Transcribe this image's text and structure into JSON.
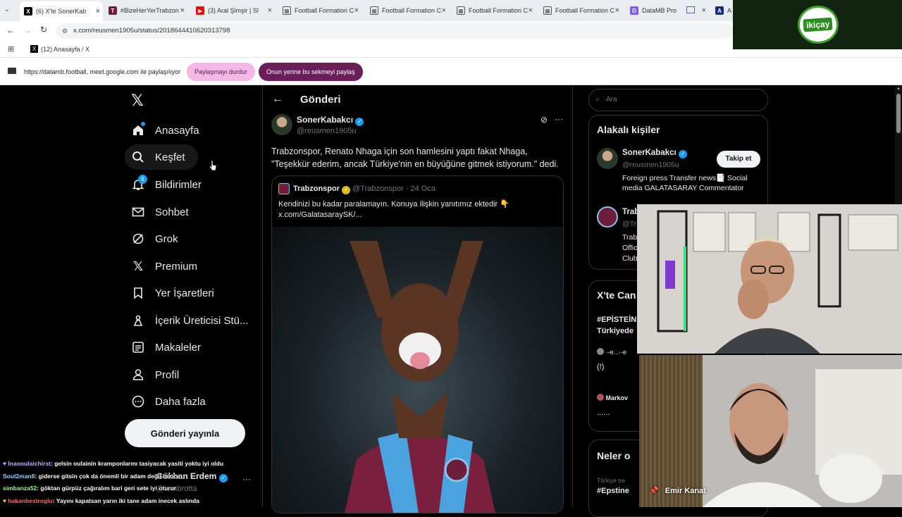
{
  "browser": {
    "tabs": [
      {
        "label": "(6) X'te SonerKab",
        "icon": "x-icon",
        "active": true
      },
      {
        "label": "#BizeHerYerTrabzon",
        "icon": "trabzon-icon"
      },
      {
        "label": "(3) Aral Şimşir | Sl",
        "icon": "youtube-icon"
      },
      {
        "label": "Football Formation C",
        "icon": "doc-icon"
      },
      {
        "label": "Football Formation C",
        "icon": "doc-icon"
      },
      {
        "label": "Football Formation C",
        "icon": "doc-icon"
      },
      {
        "label": "Football Formation C",
        "icon": "doc-icon"
      },
      {
        "label": "DataMB Pro",
        "icon": "datamb-icon"
      },
      {
        "label": "A",
        "icon": "app-icon"
      }
    ],
    "url": "x.com/reusmen1905u/status/2018644410620313798",
    "bookmark": "(12) Anasayfa / X",
    "share_text": "https://datamb.football, meet.google.com ile paylaşılıyor",
    "stop_sharing": "Paylaşmayı durdur",
    "share_this_tab": "Onun yerine bu sekmeyi paylaş"
  },
  "overlay_logo": "ikiçay",
  "nav": {
    "items": [
      {
        "label": "Anasayfa",
        "icon": "home-icon"
      },
      {
        "label": "Keşfet",
        "icon": "search-icon"
      },
      {
        "label": "Bildirimler",
        "icon": "bell-icon",
        "badge": "6"
      },
      {
        "label": "Sohbet",
        "icon": "mail-icon"
      },
      {
        "label": "Grok",
        "icon": "grok-icon"
      },
      {
        "label": "Premium",
        "icon": "x-icon"
      },
      {
        "label": "Yer İşaretleri",
        "icon": "bookmark-icon"
      },
      {
        "label": "İçerik Üreticisi Stü...",
        "icon": "creator-icon"
      },
      {
        "label": "Makaleler",
        "icon": "article-icon"
      },
      {
        "label": "Profil",
        "icon": "person-icon"
      },
      {
        "label": "Daha fazla",
        "icon": "more-icon"
      }
    ],
    "post_button": "Gönderi yayınla",
    "account_name": "Gökhan Erdem",
    "account_handle": "@tembrotta"
  },
  "post": {
    "header": "Gönderi",
    "author_name": "SonerKabakcı",
    "author_handle": "@reusmen1905u",
    "text_line1": "Trabzonspor, Renato Nhaga için son hamlesini yaptı fakat Nhaga,",
    "text_line2": "\"Teşekkür ederim, ancak Türkiye'nin en büyüğüne gitmek istiyorum.\" dedi.",
    "quote": {
      "author_name": "Trabzonspor",
      "author_handle": "@Trabzonspor",
      "date": "24 Oca",
      "text_line1": "Kendinizi bu kadar paralamayın. Konuya ilişkin yanıtımız ektedir 👇",
      "text_line2": "x.com/GalatasaraySK/..."
    }
  },
  "sidebar": {
    "search_placeholder": "Ara",
    "related_title": "Alakalı kişiler",
    "person1": {
      "name": "SonerKabakcı",
      "handle": "@reusmen1905u",
      "follow": "Takip et",
      "bio_line1": "Foreign press Transfer news📑 Social",
      "bio_line2": "media GALATASARAY Commentator"
    },
    "person2": {
      "name": "Trab",
      "handle": "@Tr",
      "bio_line1": "Trab",
      "bio_line2": "Offic",
      "bio_line3": "Club"
    },
    "trends_title": "X'te Can",
    "trend1_line1": "#EPİSTEİN",
    "trend1_line2": "Türkiyede",
    "trend_user1": "·-e...·-e",
    "trend_text1": "(!)",
    "trend_user2": "Markov",
    "trend_text2": "......",
    "news_title": "Neler o",
    "news_sub": "Türkiye tre",
    "news_tag": "#Epstine"
  },
  "cam2_label": "Emir Kanat",
  "chat": [
    {
      "user": "Inaooulaichirst",
      "user_color": "#c9a6ff",
      "text": ": gelsin oulainin kramponlarını tasiyacak yasiti yoktu iyi oldu"
    },
    {
      "user": "Soul2man8",
      "user_color": "#8fd0ff",
      "text": ": giderse gitsin çok da önemli bir adam değil bence"
    },
    {
      "user": "simbanza52",
      "user_color": "#9cff8a",
      "text": ": göktan gürpüz çağıralım bari geri sete iyi oturur"
    },
    {
      "user": "hakanbestroglu",
      "user_color": "#ff6b6b",
      "text": ": Yayını kapatsan yarın iki tane adam inecek aslında"
    }
  ]
}
